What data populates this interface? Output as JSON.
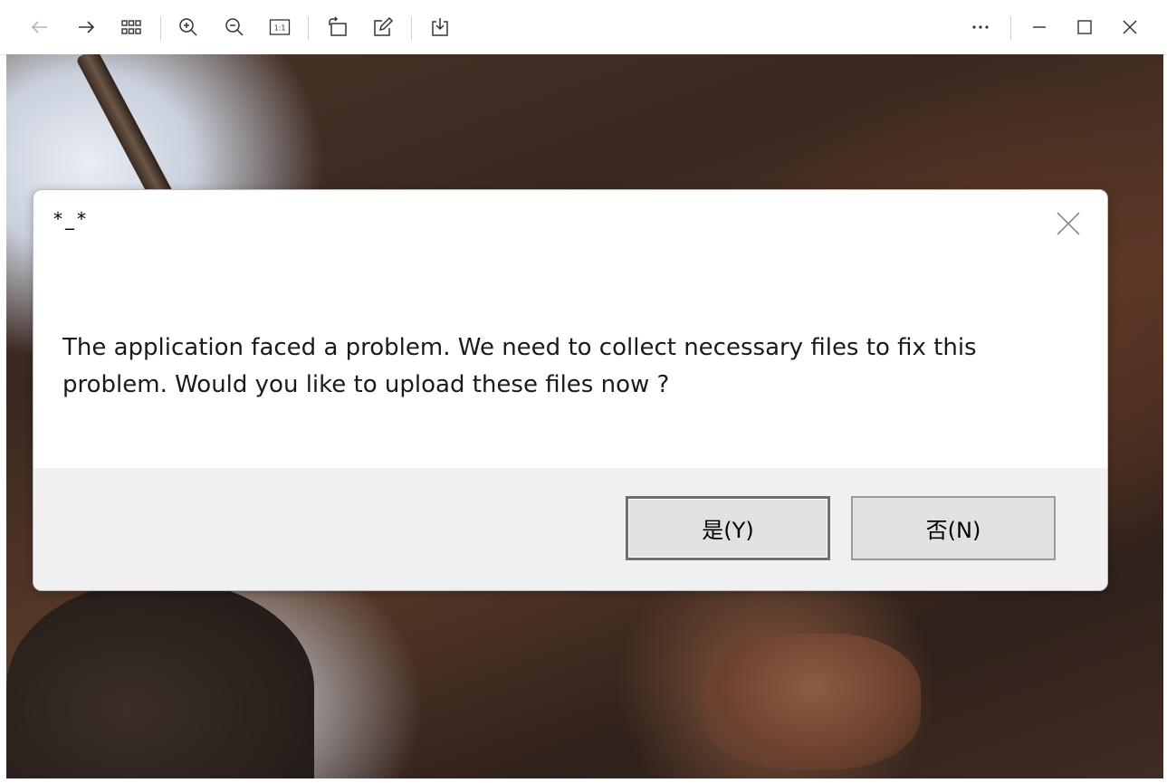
{
  "toolbar": {
    "buttons": [
      {
        "icon": "back-arrow-icon"
      },
      {
        "icon": "forward-arrow-icon"
      },
      {
        "icon": "grid-view-icon"
      },
      {
        "icon": "zoom-in-icon"
      },
      {
        "icon": "zoom-out-icon"
      },
      {
        "icon": "actual-size-icon",
        "label": "1:1"
      },
      {
        "icon": "rotate-icon"
      },
      {
        "icon": "edit-icon"
      },
      {
        "icon": "save-icon"
      },
      {
        "icon": "more-icon"
      },
      {
        "icon": "minimize-icon"
      },
      {
        "icon": "maximize-icon"
      },
      {
        "icon": "close-icon"
      }
    ]
  },
  "dialog": {
    "title": "*_*",
    "message": "The application faced a problem. We need to collect necessary files to fix this problem. Would you like to upload these files now ?",
    "yes_label": "是(Y)",
    "no_label": "否(N)"
  },
  "colors": {
    "footer_bg": "#f0f0f0",
    "button_bg": "#e1e1e1",
    "toolbar_icon": "#333333"
  }
}
